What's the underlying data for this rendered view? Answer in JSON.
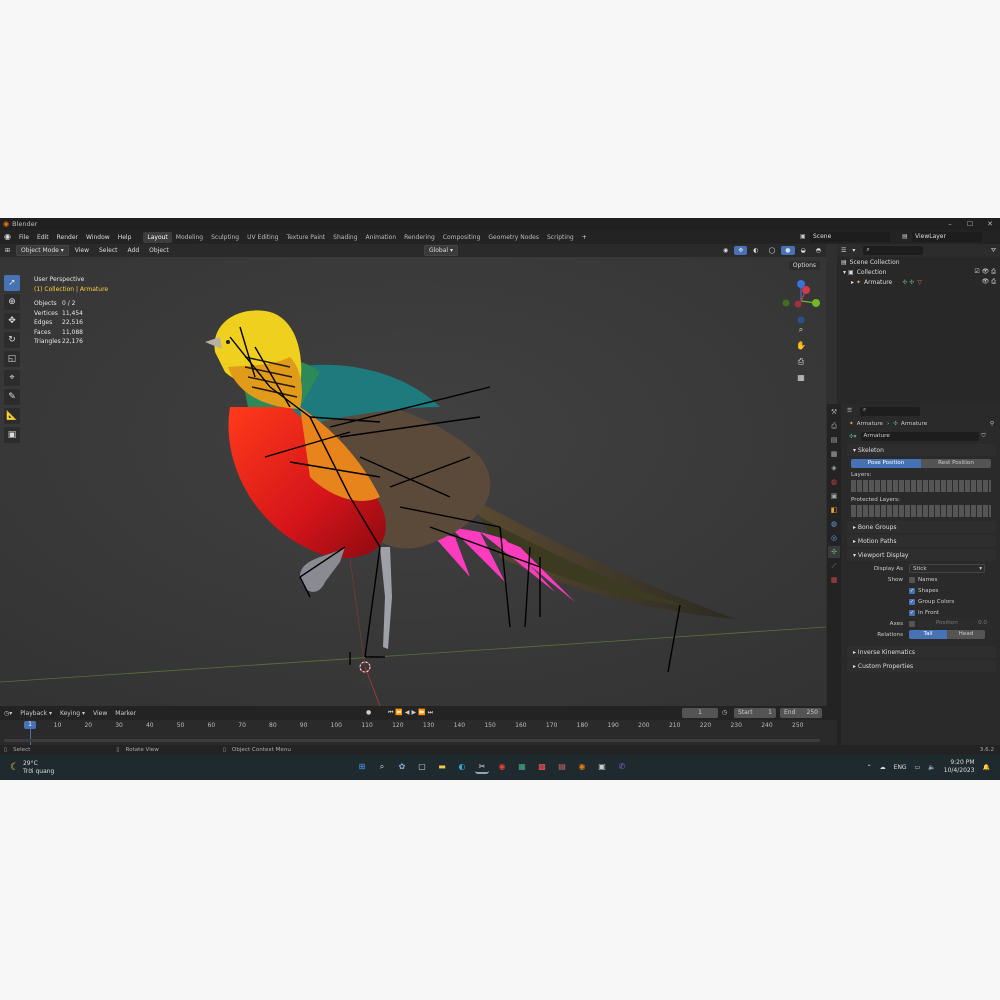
{
  "window": {
    "title": "Blender",
    "controls": [
      "–",
      "☐",
      "✕"
    ]
  },
  "menu": {
    "items": [
      "File",
      "Edit",
      "Render",
      "Window",
      "Help"
    ],
    "workspaces": [
      "Layout",
      "Modeling",
      "Sculpting",
      "UV Editing",
      "Texture Paint",
      "Shading",
      "Animation",
      "Rendering",
      "Compositing",
      "Geometry Nodes",
      "Scripting"
    ],
    "add_tab": "+",
    "scene": "Scene",
    "view_layer": "ViewLayer"
  },
  "viewport_header": {
    "mode": "Object Mode",
    "menus": [
      "View",
      "Select",
      "Add",
      "Object"
    ],
    "transform": "Global",
    "options": "Options"
  },
  "viewport": {
    "perspective": "User Perspective",
    "collection_path": "(1) Collection | Armature",
    "stats": [
      {
        "label": "Objects",
        "value": "0 / 2"
      },
      {
        "label": "Vertices",
        "value": "11,454"
      },
      {
        "label": "Edges",
        "value": "22,516"
      },
      {
        "label": "Faces",
        "value": "11,088"
      },
      {
        "label": "Triangles",
        "value": "22,176"
      }
    ],
    "gizmo": {
      "z": "Z",
      "y": "Y",
      "x": "X"
    }
  },
  "outliner": {
    "search_placeholder": "",
    "items": [
      {
        "label": "Scene Collection",
        "depth": 0
      },
      {
        "label": "Collection",
        "depth": 1
      },
      {
        "label": "Armature",
        "depth": 2
      }
    ]
  },
  "properties": {
    "breadcrumb": [
      "Armature",
      "Armature"
    ],
    "datablock": "Armature",
    "skeleton": {
      "title": "Skeleton",
      "pose_position": "Pose Position",
      "rest_position": "Rest Position",
      "layers_label": "Layers:",
      "protected_label": "Protected Layers:"
    },
    "bone_groups": "Bone Groups",
    "motion_paths": "Motion Paths",
    "viewport_display": {
      "title": "Viewport Display",
      "display_as_label": "Display As",
      "display_as_value": "Stick",
      "show_label": "Show",
      "names": "Names",
      "shapes": "Shapes",
      "group_colors": "Group Colors",
      "in_front": "In Front",
      "axes_label": "Axes",
      "position_label": "Position",
      "position_value": "0.0",
      "relations_label": "Relations",
      "tail": "Tail",
      "head": "Head"
    },
    "inverse_kinematics": "Inverse Kinematics",
    "custom_properties": "Custom Properties"
  },
  "timeline": {
    "menus": [
      "Playback",
      "Keying",
      "View",
      "Marker"
    ],
    "current_frame": "1",
    "start_label": "Start",
    "start": "1",
    "end_label": "End",
    "end": "250",
    "ticks": [
      "1",
      "10",
      "20",
      "30",
      "40",
      "50",
      "60",
      "70",
      "80",
      "90",
      "100",
      "110",
      "120",
      "130",
      "140",
      "150",
      "160",
      "170",
      "180",
      "190",
      "200",
      "210",
      "220",
      "230",
      "240",
      "250"
    ]
  },
  "statusbar": {
    "select": "Select",
    "rotate": "Rotate View",
    "context": "Object Context Menu",
    "version": "3.6.2"
  },
  "taskbar": {
    "weather_temp": "29°C",
    "weather_desc": "Trời quang",
    "lang": "ENG",
    "time": "9:20 PM",
    "date": "10/4/2023"
  },
  "colors": {
    "accent": "#4772b3",
    "highlight": "#ffd23b",
    "bone_selected": "#ff3cbe"
  }
}
